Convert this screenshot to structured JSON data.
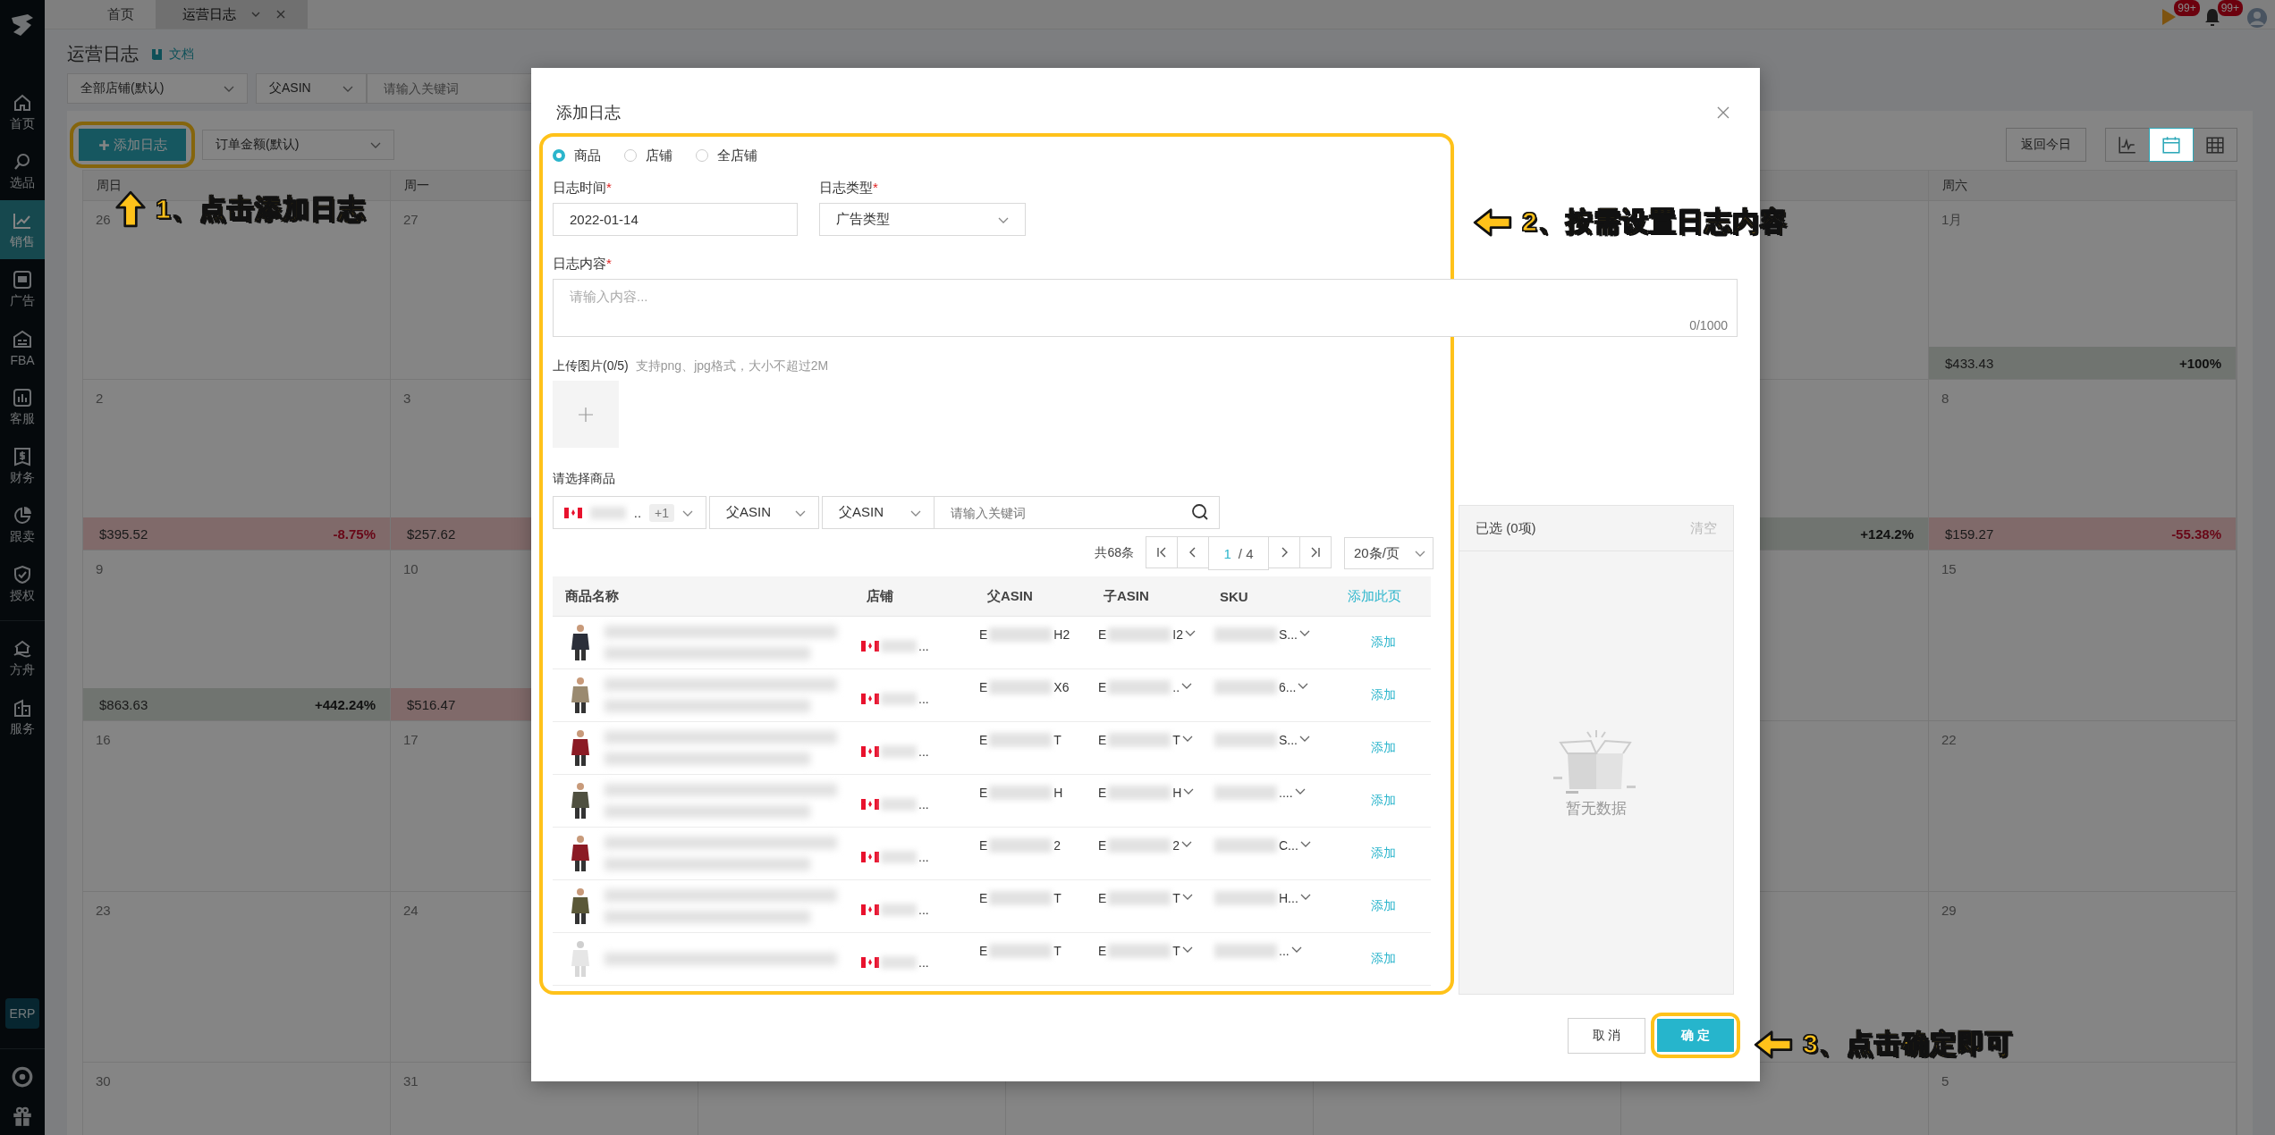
{
  "sidebar": {
    "items": [
      {
        "label": "首页",
        "selected": false
      },
      {
        "label": "选品",
        "selected": false
      },
      {
        "label": "销售",
        "selected": true
      },
      {
        "label": "广告",
        "selected": false
      },
      {
        "label": "FBA",
        "selected": false
      },
      {
        "label": "客服",
        "selected": false
      },
      {
        "label": "财务",
        "selected": false
      },
      {
        "label": "跟卖",
        "selected": false
      },
      {
        "label": "授权",
        "selected": false
      }
    ],
    "extra_items": [
      {
        "label": "方舟",
        "selected": false
      },
      {
        "label": "服务",
        "selected": false
      }
    ],
    "erp": "ERP"
  },
  "tabs": [
    {
      "label": "首页",
      "selected": false,
      "closable": false
    },
    {
      "label": "运营日志",
      "selected": true,
      "closable": true
    }
  ],
  "notifications": [
    {
      "badge": "99+"
    },
    {
      "badge": "99+"
    }
  ],
  "page": {
    "title": "运营日志",
    "doc_link": "文档",
    "store_select": "全部店铺(默认)",
    "asin_select": "父ASIN",
    "keyword_placeholder": "请输入关键词"
  },
  "toolbar": {
    "add_button": "添加日志",
    "metric_select": "订单金额(默认)",
    "today_button": "返回今日",
    "views": [
      {
        "selected": false
      },
      {
        "selected": true
      },
      {
        "selected": false
      }
    ]
  },
  "calendar": {
    "weekdays": {
      "sun": "周日",
      "mon": "周一",
      "sat": "周六"
    },
    "weeks": [
      {
        "sun": {
          "date": "26"
        },
        "mon": {
          "date": "27"
        },
        "sat": {
          "date": "1月",
          "amount": "$433.43",
          "change": "+100%",
          "decline": false
        }
      },
      {
        "sun": {
          "date": "2",
          "amount": "$395.52",
          "change": "-8.75%",
          "decline": true
        },
        "mon": {
          "date": "3",
          "amount": "$257.62",
          "decline": true
        },
        "fri": {
          "change": "+124.2%",
          "decline": false
        },
        "sat": {
          "date": "8",
          "amount": "$159.27",
          "change": "-55.38%",
          "decline": true
        }
      },
      {
        "sun": {
          "date": "9",
          "amount": "$863.63",
          "change": "+442.24%",
          "decline": false
        },
        "mon": {
          "date": "10",
          "amount": "$516.47",
          "decline": true
        },
        "sat": {
          "date": "15"
        }
      },
      {
        "sun": {
          "date": "16"
        },
        "mon": {
          "date": "17"
        },
        "sat": {
          "date": "22"
        }
      },
      {
        "sun": {
          "date": "23"
        },
        "mon": {
          "date": "24"
        },
        "sat": {
          "date": "29"
        }
      },
      {
        "sun": {
          "date": "30"
        },
        "mon": {
          "date": "31"
        },
        "sat": {
          "date": "5"
        }
      }
    ]
  },
  "dialog": {
    "title": "添加日志",
    "radios": [
      {
        "label": "商品",
        "selected": true
      },
      {
        "label": "店铺",
        "selected": false
      },
      {
        "label": "全店铺",
        "selected": false
      }
    ],
    "time_label": "日志时间",
    "time_mark": "*",
    "time_value": "2022-01-14",
    "type_label": "日志类型",
    "type_mark": "*",
    "type_value": "广告类型",
    "content_label": "日志内容",
    "content_mark": "*",
    "content_placeholder": "请输入内容...",
    "counter": "0/1000",
    "upload_label": "上传图片(0/5)",
    "upload_hint": "支持png、jpg格式，大小不超过2M",
    "product_label": "请选择商品",
    "store_filter": {
      "tail": "..",
      "extra": "+1"
    },
    "asin_select_1": "父ASIN",
    "asin_select_2": "父ASIN",
    "keyword_placeholder": "请输入关键词",
    "total": "共68条",
    "page_current": "1",
    "page_total": "/ 4",
    "page_size": "20条/页",
    "columns": [
      "商品名称",
      "店铺",
      "父ASIN",
      "子ASIN",
      "SKU"
    ],
    "add_page": "添加此页",
    "rows": [
      {
        "store_tail": "...",
        "parent_head": "E",
        "parent_tail": "H2",
        "child_head": "E",
        "child_tail": "I2",
        "sku_tail": "S...",
        "action": "添加"
      },
      {
        "store_tail": "...",
        "parent_head": "E",
        "parent_tail": "X6",
        "child_head": "E",
        "child_tail": "..",
        "sku_tail": "6...",
        "action": "添加"
      },
      {
        "store_tail": "...",
        "parent_head": "E",
        "parent_tail": "T",
        "child_head": "E",
        "child_tail": "T",
        "sku_tail": "S...",
        "action": "添加"
      },
      {
        "store_tail": "...",
        "parent_head": "E",
        "parent_tail": "H",
        "child_head": "E",
        "child_tail": "H",
        "sku_tail": "....",
        "action": "添加"
      },
      {
        "store_tail": "...",
        "parent_head": "E",
        "parent_tail": "2",
        "child_head": "E",
        "child_tail": "2",
        "sku_tail": "C...",
        "action": "添加"
      },
      {
        "store_tail": "...",
        "parent_head": "E",
        "parent_tail": "T",
        "child_head": "E",
        "child_tail": "T",
        "sku_tail": "H...",
        "action": "添加"
      },
      {
        "store_tail": "...",
        "parent_head": "E",
        "parent_tail": "T",
        "child_head": "E",
        "child_tail": "T",
        "sku_tail": "...",
        "action": "添加"
      }
    ],
    "selected_title": "已选 (0项)",
    "clear": "清空",
    "empty": "暂无数据",
    "cancel": "取 消",
    "ok": "确 定"
  },
  "annotations": [
    {
      "kind": "up",
      "text": "1、点击添加日志"
    },
    {
      "kind": "left",
      "text": "2、按需设置日志内容"
    },
    {
      "kind": "left",
      "text": "3、点击确定即可"
    }
  ]
}
